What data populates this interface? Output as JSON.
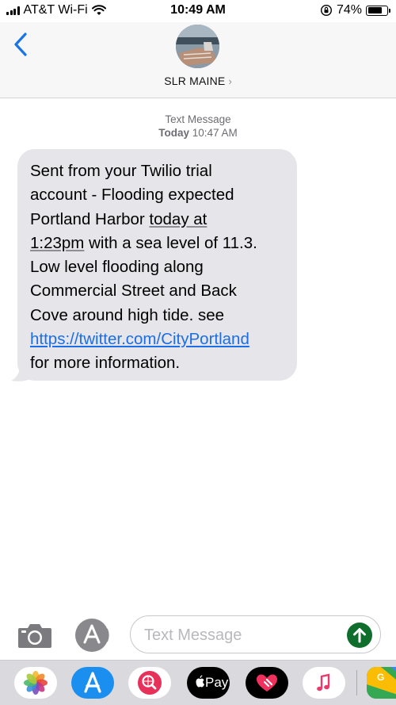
{
  "status_bar": {
    "carrier": "AT&T Wi-Fi",
    "time": "10:49 AM",
    "battery_percent_label": "74%",
    "battery_level": 0.74
  },
  "header": {
    "contact_name": "SLR MAINE",
    "back_icon": "chevron-left-icon",
    "accent_color": "#1a73e8"
  },
  "conversation": {
    "meta_label": "Text Message",
    "meta_day": "Today",
    "meta_time": "10:47 AM",
    "message": {
      "line1": "Sent from your Twilio trial",
      "line2": "account - Flooding expected",
      "line3_a": "Portland Harbor ",
      "line3_b": "today at",
      "line4_a": "1:23pm",
      "line4_b": " with a sea level of 11.3.",
      "line5": "Low level flooding along",
      "line6": "Commercial Street and Back",
      "line7": "Cove around high tide. see",
      "link": "https://twitter.com/CityPortland",
      "line9": "for more information."
    },
    "bubble_color": "#e5e5ea"
  },
  "input_bar": {
    "placeholder": "Text Message",
    "send_color": "#0f6e2c"
  },
  "drawer": {
    "apple_pay_label": "Pay",
    "apps": [
      "photos-icon",
      "app-store-icon",
      "web-search-icon",
      "apple-pay-icon",
      "digital-touch-icon",
      "music-icon",
      "google-maps-icon"
    ]
  }
}
